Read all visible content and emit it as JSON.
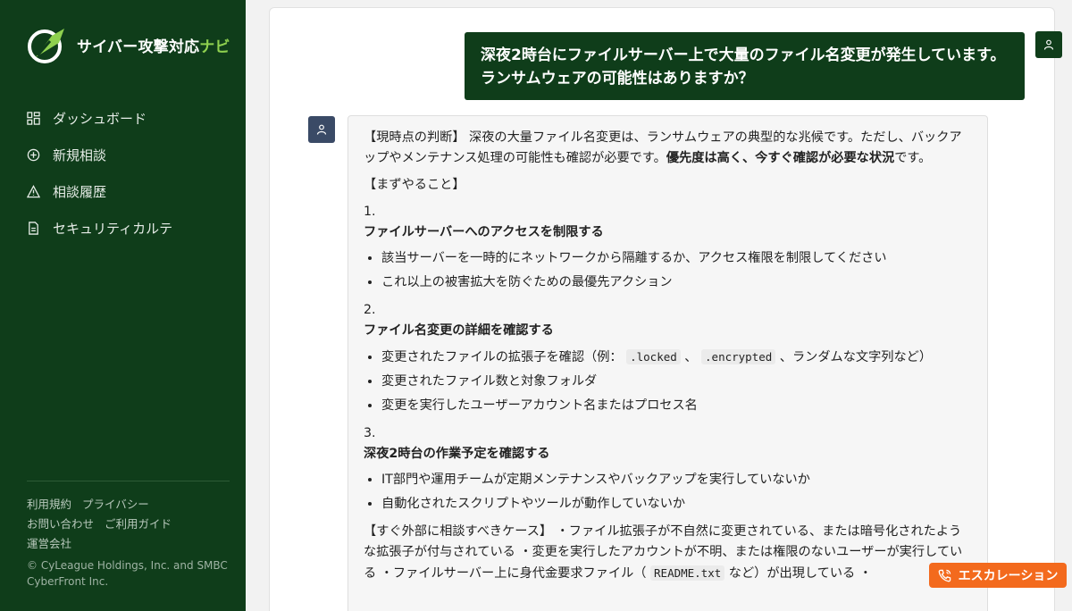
{
  "brand": {
    "name_main": "サイバー攻撃対応",
    "name_accent": "ナビ"
  },
  "sidebar": {
    "items": [
      {
        "label": "ダッシュボード",
        "icon": "grid-icon"
      },
      {
        "label": "新規相談",
        "icon": "plus-circle-icon"
      },
      {
        "label": "相談履歴",
        "icon": "warning-icon"
      },
      {
        "label": "セキュリティカルテ",
        "icon": "document-icon"
      }
    ],
    "footer_links": [
      "利用規約",
      "プライバシー",
      "お問い合わせ",
      "ご利用ガイド",
      "運営会社"
    ],
    "copyright": "© CyLeague Holdings, Inc. and SMBC CyberFront Inc."
  },
  "chat": {
    "user_message_line1": "深夜2時台にファイルサーバー上で大量のファイル名変更が発生しています。",
    "user_message_line2": "ランサムウェアの可能性はありますか？",
    "assistant": {
      "judgment_prefix": "【現時点の判断】 深夜の大量ファイル名変更は、ランサムウェアの典型的な兆候です。ただし、バックアップやメンテナンス処理の可能性も確認が必要です。",
      "judgment_bold": "優先度は高く、今すぐ確認が必要な状況",
      "judgment_suffix": "です。",
      "todo_heading": "【まずやること】",
      "steps": [
        {
          "num": "1.",
          "title": "ファイルサーバーへのアクセスを制限する",
          "bullets": [
            "該当サーバーを一時的にネットワークから隔離するか、アクセス権限を制限してください",
            "これ以上の被害拡大を防ぐための最優先アクション"
          ]
        },
        {
          "num": "2.",
          "title": "ファイル名変更の詳細を確認する",
          "bullet_ext_prefix": "変更されたファイルの拡張子を確認（例：",
          "code1": ".locked",
          "sep": "、",
          "code2": ".encrypted",
          "bullet_ext_suffix": "、ランダムな文字列など）",
          "bullets": [
            "変更されたファイル数と対象フォルダ",
            "変更を実行したユーザーアカウント名またはプロセス名"
          ]
        },
        {
          "num": "3.",
          "title": "深夜2時台の作業予定を確認する",
          "bullets": [
            "IT部門や運用チームが定期メンテナンスやバックアップを実行していないか",
            "自動化されたスクリプトやツールが動作していないか"
          ]
        }
      ],
      "escalate_text_1": "【すぐ外部に相談すべきケース】 ・ファイル拡張子が不自然に変更されている、または暗号化されたような拡張子が付与されている ・変更を実行したアカウントが不明、または権限のないユーザーが実行している ・ファイルサーバー上に身代金要求ファイル（",
      "escalate_code": "README.txt",
      "escalate_text_2": "など）が出現している ・"
    }
  },
  "escalation_button": {
    "label": "エスカレーション"
  },
  "colors": {
    "sidebar_bg": "#0f3d1a",
    "accent_green": "#8fd14f",
    "escalation_orange": "#f36a1d",
    "bot_avatar": "#3a4a66"
  }
}
